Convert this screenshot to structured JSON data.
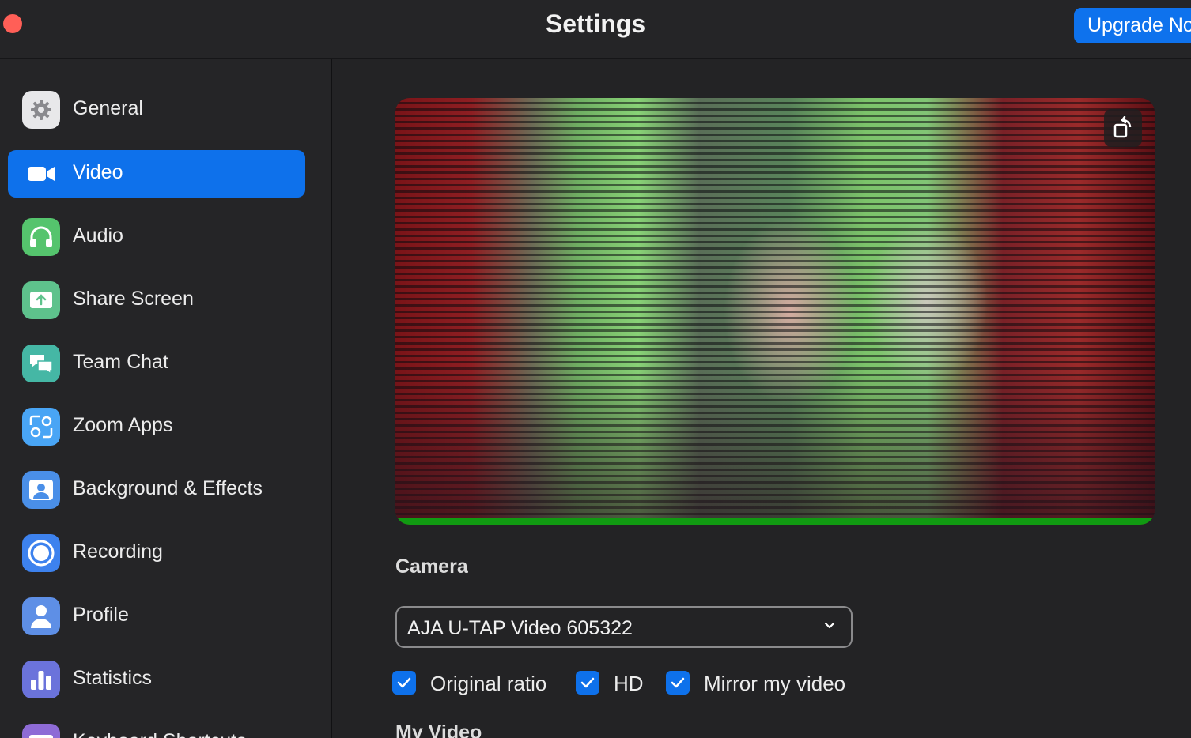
{
  "window": {
    "title": "Settings",
    "upgrade_label": "Upgrade Now"
  },
  "sidebar": {
    "items": [
      {
        "label": "General",
        "icon": "gear-icon",
        "color": "#e8e8ea",
        "active": false
      },
      {
        "label": "Video",
        "icon": "video-camera-icon",
        "color": "#0e71eb",
        "active": true
      },
      {
        "label": "Audio",
        "icon": "headphones-icon",
        "color": "#55c46d",
        "active": false
      },
      {
        "label": "Share Screen",
        "icon": "share-screen-icon",
        "color": "#5ec28c",
        "active": false
      },
      {
        "label": "Team Chat",
        "icon": "chat-bubbles-icon",
        "color": "#45b7a5",
        "active": false
      },
      {
        "label": "Zoom Apps",
        "icon": "apps-icon",
        "color": "#49a5f5",
        "active": false
      },
      {
        "label": "Background & Effects",
        "icon": "background-person-icon",
        "color": "#4a8fe8",
        "active": false
      },
      {
        "label": "Recording",
        "icon": "record-icon",
        "color": "#3d82ee",
        "active": false
      },
      {
        "label": "Profile",
        "icon": "profile-person-icon",
        "color": "#5e8fe6",
        "active": false
      },
      {
        "label": "Statistics",
        "icon": "bar-stats-icon",
        "color": "#6b73db",
        "active": false
      },
      {
        "label": "Keyboard Shortcuts",
        "icon": "keyboard-icon",
        "color": "#8e6bd6",
        "active": false
      }
    ]
  },
  "video": {
    "camera_heading": "Camera",
    "camera_selected": "AJA U-TAP Video 605322",
    "checkboxes": [
      {
        "label": "Original ratio",
        "checked": true
      },
      {
        "label": "HD",
        "checked": true
      },
      {
        "label": "Mirror my video",
        "checked": true
      }
    ],
    "my_video_heading": "My Video"
  },
  "colors": {
    "accent": "#0e71eb",
    "close": "#ff5f57",
    "preview_active_bar": "#119a12"
  }
}
